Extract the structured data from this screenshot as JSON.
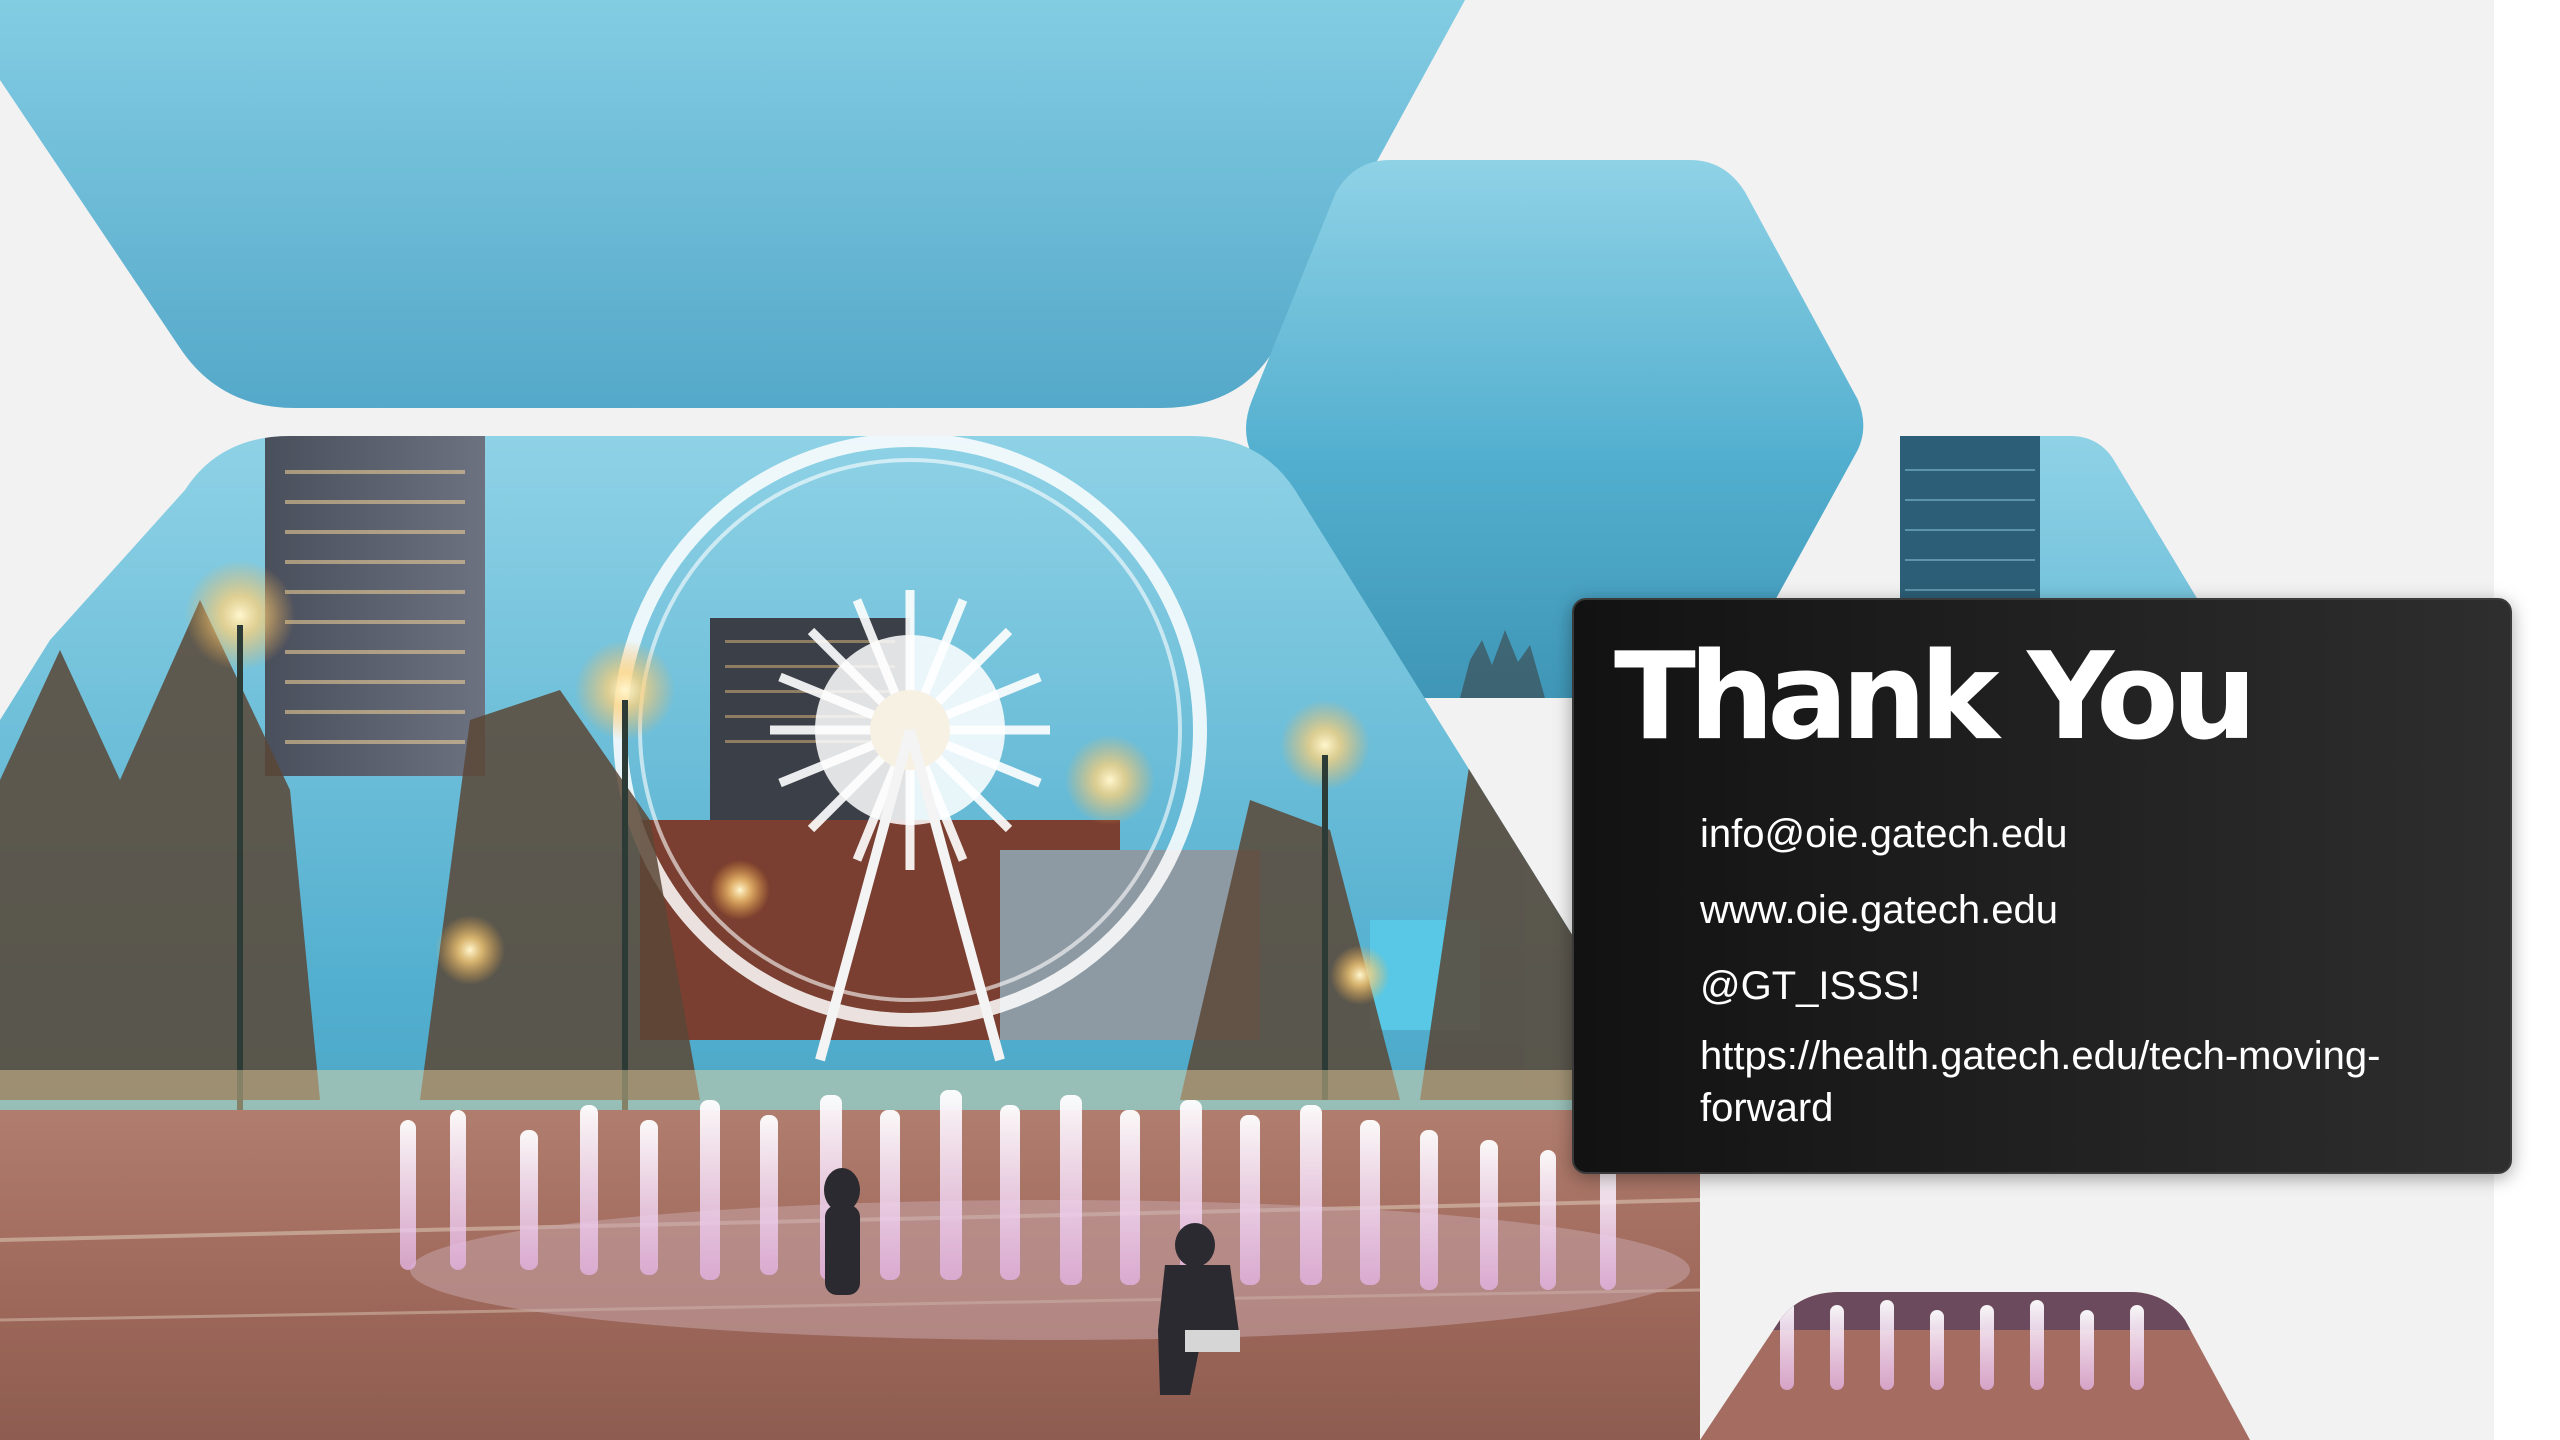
{
  "slide": {
    "title": "Thank You",
    "contacts": [
      "info@oie.gatech.edu",
      "www.oie.gatech.edu",
      "@GT_ISSS!",
      "https://health.gatech.edu/tech-moving-forward"
    ],
    "photo_subject": "Centennial Olympic Park fountains and Ferris wheel at dusk"
  },
  "colors": {
    "background": "#f2f2f2",
    "sky": "#5bb3d0",
    "card": "#1e1e1e",
    "text": "#ffffff"
  }
}
